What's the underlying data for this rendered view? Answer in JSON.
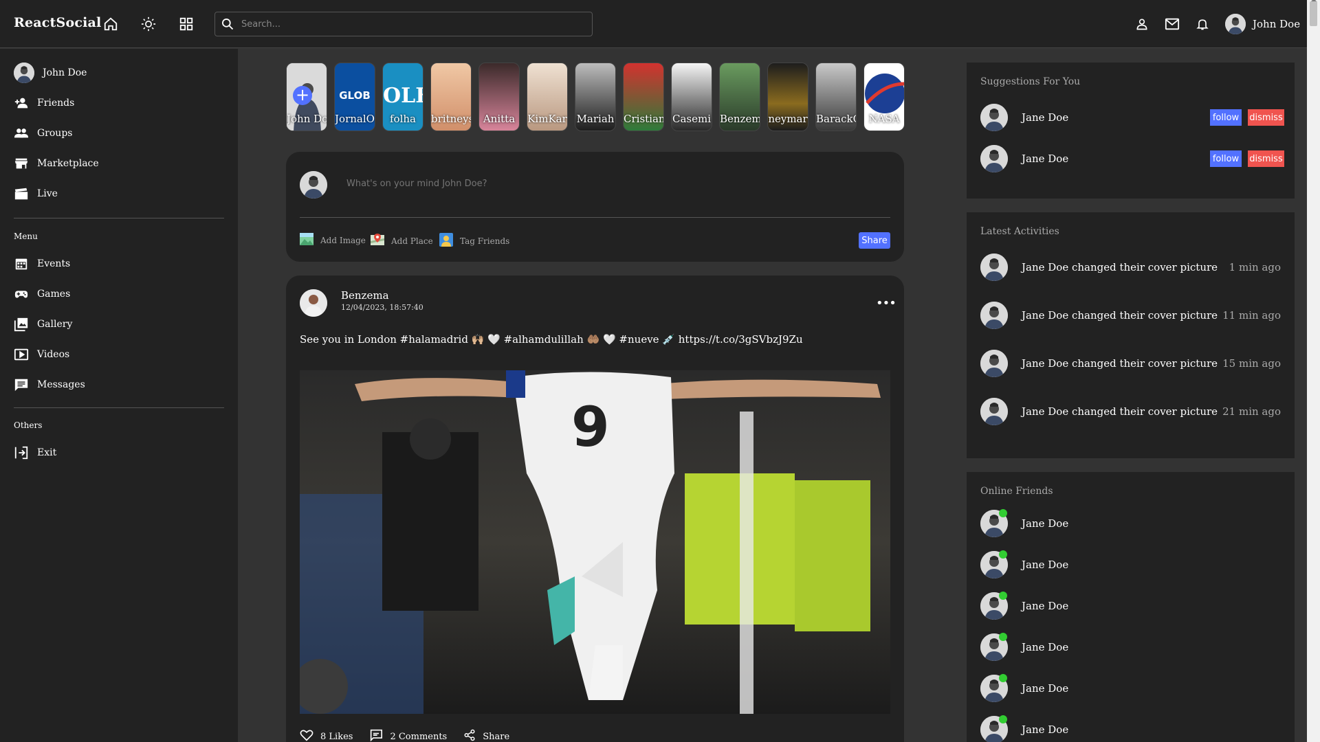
{
  "app": {
    "logo": "ReactSocial"
  },
  "nav": {
    "search_placeholder": "Search...",
    "user_name": "John Doe"
  },
  "left": {
    "profile_name": "John Doe",
    "items": [
      {
        "label": "Friends",
        "icon": "person-add-icon"
      },
      {
        "label": "Groups",
        "icon": "groups-icon"
      },
      {
        "label": "Marketplace",
        "icon": "storefront-icon"
      },
      {
        "label": "Live",
        "icon": "clapperboard-icon"
      }
    ],
    "menu_title": "Menu",
    "menu_items": [
      {
        "label": "Events",
        "icon": "calendar-icon"
      },
      {
        "label": "Games",
        "icon": "gamepad-icon"
      },
      {
        "label": "Gallery",
        "icon": "gallery-icon"
      },
      {
        "label": "Videos",
        "icon": "video-icon"
      },
      {
        "label": "Messages",
        "icon": "message-icon"
      }
    ],
    "others_title": "Others",
    "others_items": [
      {
        "label": "Exit",
        "icon": "exit-icon"
      }
    ]
  },
  "stories": [
    {
      "name": "John Doe",
      "color": "#d8d8d8"
    },
    {
      "name": "JornalO",
      "color": "#0b4fa0"
    },
    {
      "name": "folha",
      "color": "#1a8fc2"
    },
    {
      "name": "britneys",
      "color": "#e7b48f"
    },
    {
      "name": "Anitta",
      "color": "#c87d8f"
    },
    {
      "name": "KimKar",
      "color": "#d8c2b0"
    },
    {
      "name": "Mariah",
      "color": "#5a5a5a"
    },
    {
      "name": "Cristian",
      "color": "#c7302d"
    },
    {
      "name": "Casemi",
      "color": "#e8e8e8"
    },
    {
      "name": "Benzem",
      "color": "#3e6b3d"
    },
    {
      "name": "neymar",
      "color": "#3a3a3a"
    },
    {
      "name": "BarackO",
      "color": "#8d8d8d"
    },
    {
      "name": "NASA",
      "color": "#1c3f94"
    }
  ],
  "share": {
    "placeholder": "What's on your mind John Doe?",
    "options": [
      {
        "label": "Add Image",
        "icon": "image-icon"
      },
      {
        "label": "Add Place",
        "icon": "map-icon"
      },
      {
        "label": "Tag Friends",
        "icon": "tag-friends-icon"
      }
    ],
    "button": "Share"
  },
  "post": {
    "author": "Benzema",
    "date": "12/04/2023, 18:57:40",
    "text": "See you in London #halamadrid 🙌🏼 🤍 #alhamdulillah 🤲🏽 🤍 #nueve 💉 https://t.co/3gSVbzJ9Zu",
    "likes": "8 Likes",
    "comments": "2 Comments",
    "share": "Share",
    "jersey_number": "9"
  },
  "suggestions": {
    "title": "Suggestions For You",
    "items": [
      {
        "name": "Jane Doe",
        "follow": "follow",
        "dismiss": "dismiss"
      },
      {
        "name": "Jane Doe",
        "follow": "follow",
        "dismiss": "dismiss"
      }
    ]
  },
  "activities": {
    "title": "Latest Activities",
    "items": [
      {
        "text": "Jane Doe changed their cover picture",
        "time": "1 min ago"
      },
      {
        "text": "Jane Doe changed their cover picture",
        "time": "11 min ago"
      },
      {
        "text": "Jane Doe changed their cover picture",
        "time": "15 min ago"
      },
      {
        "text": "Jane Doe changed their cover picture",
        "time": "21 min ago"
      }
    ]
  },
  "online": {
    "title": "Online Friends",
    "items": [
      {
        "name": "Jane Doe"
      },
      {
        "name": "Jane Doe"
      },
      {
        "name": "Jane Doe"
      },
      {
        "name": "Jane Doe"
      },
      {
        "name": "Jane Doe"
      },
      {
        "name": "Jane Doe"
      }
    ]
  },
  "colors": {
    "accent": "#5271ff",
    "danger": "#f0544f",
    "online": "#32cd32",
    "panel": "#222222",
    "background": "#333333"
  }
}
